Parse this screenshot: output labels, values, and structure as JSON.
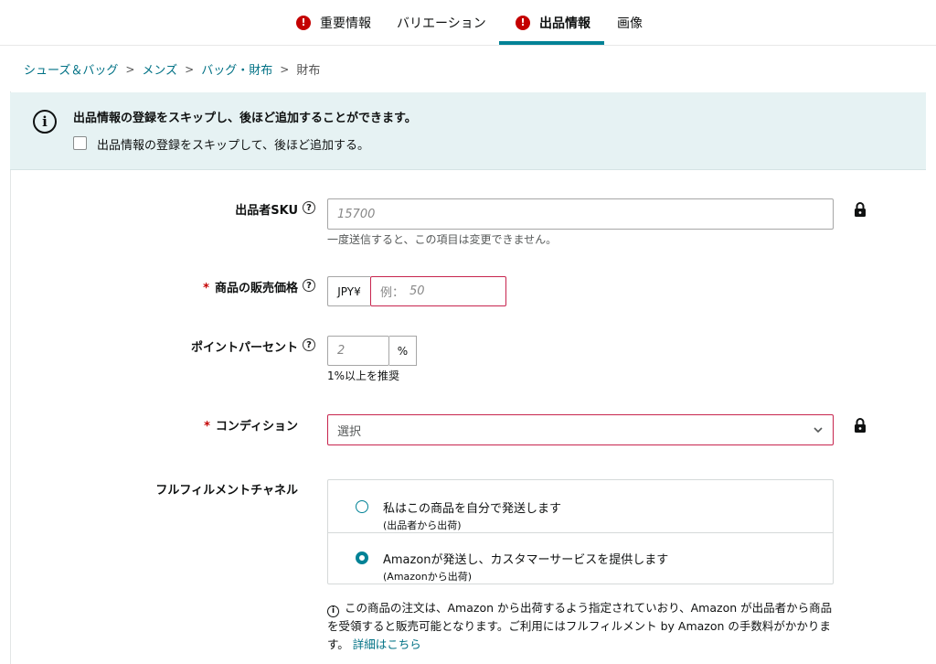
{
  "tabs": [
    {
      "label": "重要情報",
      "alert": true,
      "active": false
    },
    {
      "label": "バリエーション",
      "alert": false,
      "active": false
    },
    {
      "label": "出品情報",
      "alert": true,
      "active": true
    },
    {
      "label": "画像",
      "alert": false,
      "active": false
    }
  ],
  "breadcrumb": [
    "シューズ＆バッグ",
    "メンズ",
    "バッグ・財布",
    "財布"
  ],
  "banner": {
    "title": "出品情報の登録をスキップし、後ほど追加することができます。",
    "checkbox_label": "出品情報の登録をスキップして、後ほど追加する。",
    "checked": false
  },
  "form": {
    "sku": {
      "label": "出品者SKU",
      "value": "15700",
      "hint": "一度送信すると、この項目は変更できません。"
    },
    "price": {
      "label": "商品の販売価格",
      "required": true,
      "currency": "JPY¥",
      "placeholder_prefix": "例：",
      "placeholder_value": "50"
    },
    "points": {
      "label": "ポイントパーセント",
      "value": "2",
      "unit": "%",
      "hint": "1%以上を推奨"
    },
    "condition": {
      "label": "コンディション",
      "required": true,
      "selected": "選択"
    },
    "fulfillment": {
      "label": "フルフィルメントチャネル",
      "options": [
        {
          "main": "私はこの商品を自分で発送します",
          "sub": "(出品者から出荷)",
          "selected": false
        },
        {
          "main": "Amazonが発送し、カスタマーサービスを提供します",
          "sub": "(Amazonから出荷)",
          "selected": true
        }
      ]
    }
  },
  "note": {
    "text": "この商品の注文は、Amazon から出荷するよう指定されていおり、Amazon が出品者から商品を受領すると販売可能となります。ご利用にはフルフィルメント by Amazon の手数料がかかります。",
    "link": "詳細はこちら"
  },
  "colors": {
    "accent": "#008296",
    "alert": "#c40000",
    "link": "#007185",
    "error_border": "#c7254e",
    "banner_bg": "#e6f2f3"
  },
  "icons": {
    "tab_alert": "exclamation-circle-icon",
    "banner": "info-circle-icon",
    "help": "question-circle-icon",
    "lock": "lock-icon",
    "select": "chevron-down-icon",
    "note": "info-circle-icon"
  }
}
